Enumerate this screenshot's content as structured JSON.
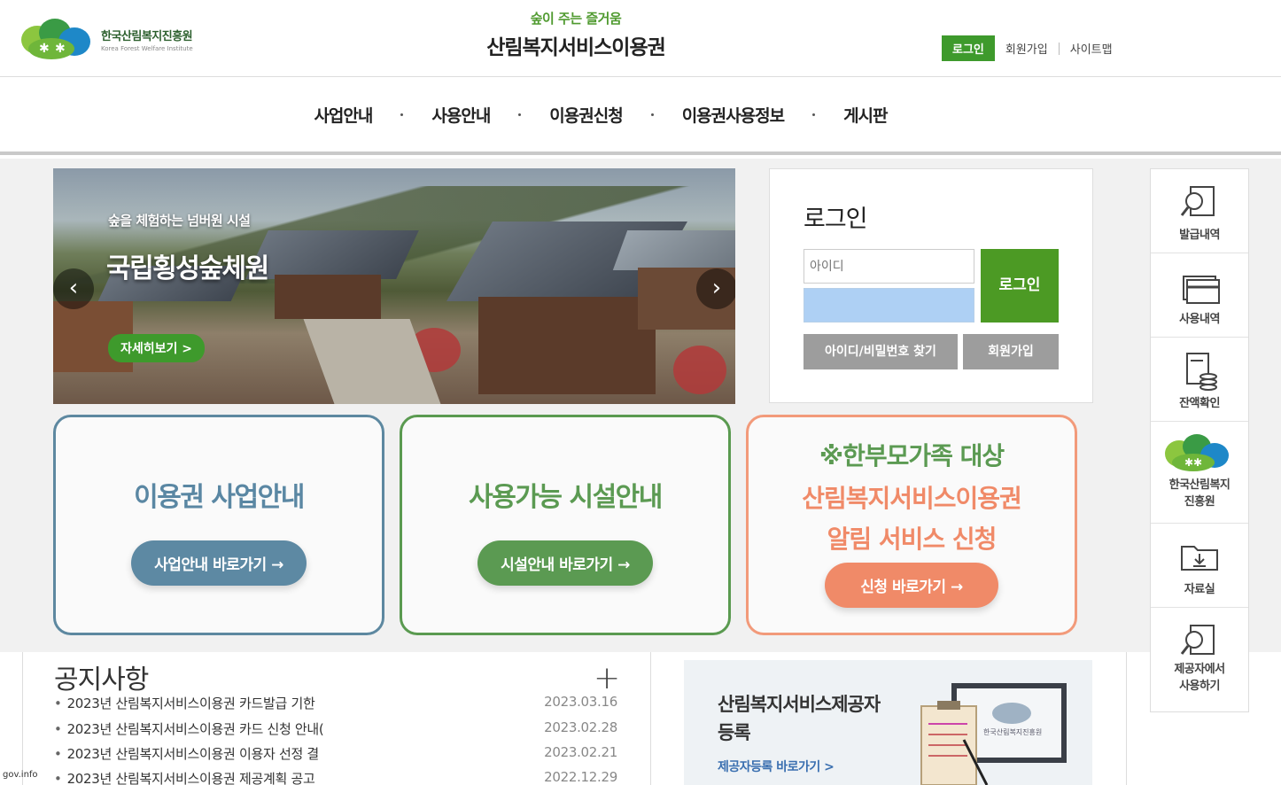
{
  "header": {
    "logo_kr": "한국산림복지진흥원",
    "logo_en": "Korea Forest Welfare Institute",
    "slogan": "숲이 주는 즐거움",
    "title": "산림복지서비스이용권",
    "util": {
      "login": "로그인",
      "join": "회원가입",
      "sitemap": "사이트맵"
    }
  },
  "nav": {
    "items": [
      "사업안내",
      "사용안내",
      "이용권신청",
      "이용권사용정보",
      "게시판"
    ]
  },
  "banner": {
    "subtitle": "숲을 체험하는 넘버원 시설",
    "title": "국립횡성숲체원",
    "button": "자세히보기 >",
    "prev": "‹",
    "next": "›"
  },
  "login": {
    "title": "로그인",
    "id_placeholder": "아이디",
    "login_button": "로그인",
    "find_button": "아이디/비밀번호 찾기",
    "join_button": "회원가입"
  },
  "cards": {
    "c1": {
      "title": "이용권 사업안내",
      "button": "사업안내 바로가기 →"
    },
    "c2": {
      "title": "사용가능 시설안내",
      "button": "시설안내 바로가기 →"
    },
    "c3": {
      "line1": "※한부모가족 대상",
      "line2": "산림복지서비스이용권",
      "line3": "알림 서비스 신청",
      "button": "신청 바로가기 →"
    }
  },
  "quick": {
    "items": [
      "발급내역",
      "사용내역",
      "잔액확인",
      "한국산림복지\n진흥원",
      "자료실",
      "제공자에서\n사용하기"
    ]
  },
  "notice": {
    "title": "공지사항",
    "plus": "+",
    "rows": [
      {
        "title": "2023년 산림복지서비스이용권 카드발급 기한",
        "date": "2023.03.16"
      },
      {
        "title": "2023년 산림복지서비스이용권 카드 신청 안내(",
        "date": "2023.02.28"
      },
      {
        "title": "2023년 산림복지서비스이용권 이용자 선정 결",
        "date": "2023.02.21"
      },
      {
        "title": "2023년 산림복지서비스이용권 제공계획 공고",
        "date": "2022.12.29"
      }
    ]
  },
  "provider": {
    "title_l1": "산림복지서비스제공자",
    "title_l2": "등록",
    "link": "제공자등록 바로가기 >",
    "monitor_text": "한국산림복지진흥원"
  },
  "footer_status": "gov.info",
  "colors": {
    "green": "#3e9a2c",
    "blue_card": "#5d88a0",
    "green_card": "#5a9a50",
    "orange_card": "#f29a7a"
  }
}
